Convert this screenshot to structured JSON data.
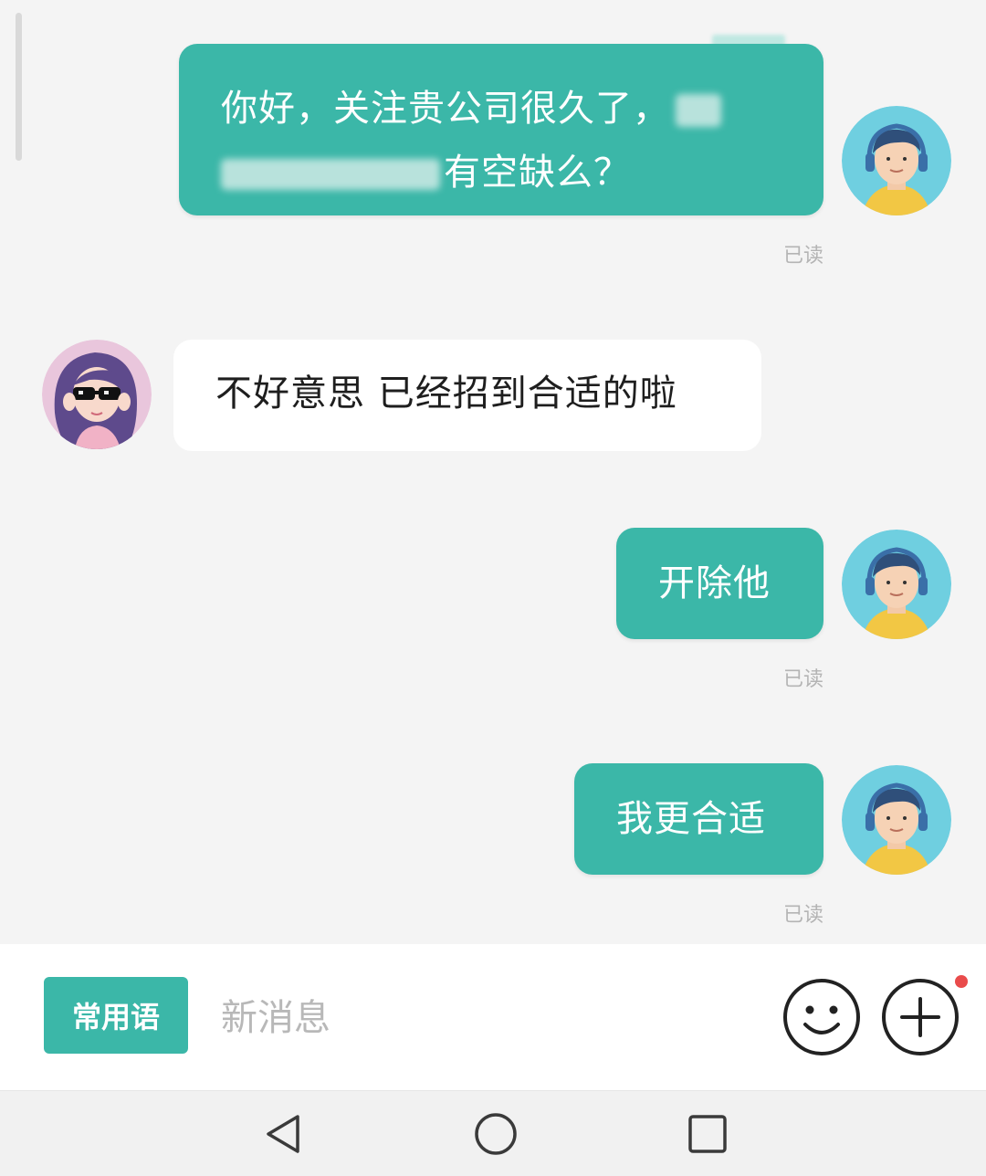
{
  "chat": {
    "messages": [
      {
        "sender": "me",
        "line1": "你好，关注贵公司很久了，",
        "line2": "有空缺么？",
        "status": "已读"
      },
      {
        "sender": "other",
        "text": "不好意思 已经招到合适的啦"
      },
      {
        "sender": "me",
        "text": "开除他",
        "status": "已读"
      },
      {
        "sender": "me",
        "text": "我更合适",
        "status": "已读"
      }
    ]
  },
  "input_bar": {
    "phrase_button": "常用语",
    "placeholder": "新消息",
    "emoji_icon": "smiley-icon",
    "plus_icon": "plus-circle-icon",
    "notification_dot_color": "#e94b4b"
  },
  "nav_bar": {
    "back_icon": "triangle-back-icon",
    "home_icon": "circle-home-icon",
    "recents_icon": "square-recents-icon"
  },
  "colors": {
    "accent": "#3bb7a8",
    "background": "#f4f4f4"
  }
}
